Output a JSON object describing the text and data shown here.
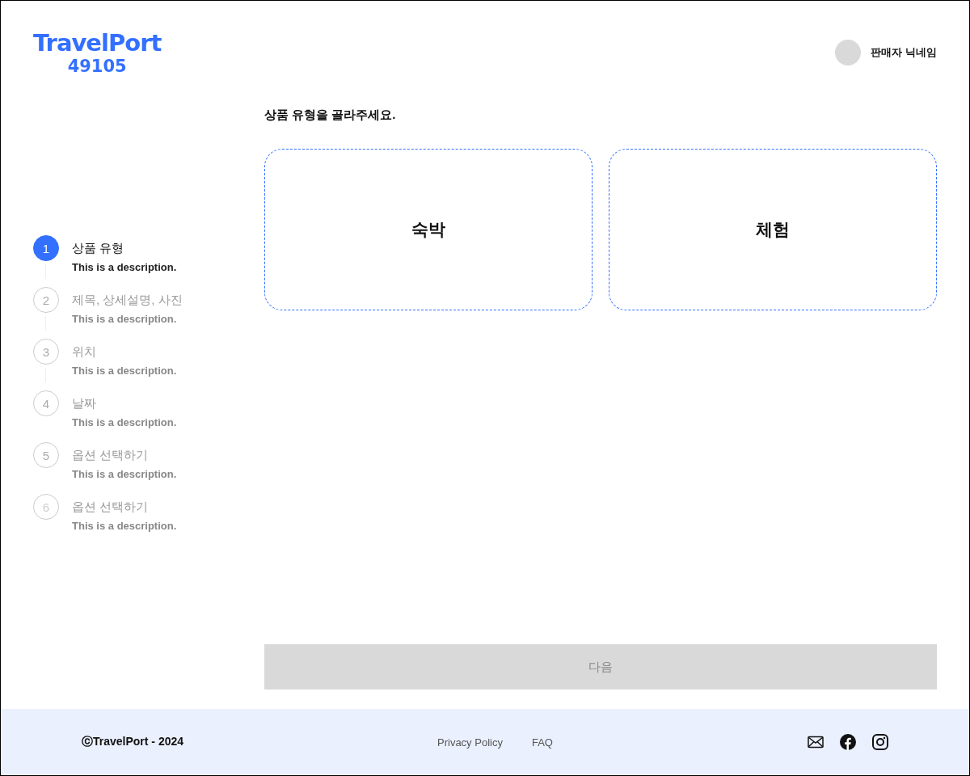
{
  "logo": {
    "name": "TravelPort",
    "code": "49105"
  },
  "user": {
    "nickname": "판매자 닉네임"
  },
  "steps": [
    {
      "number": "1",
      "title": "상품 유형",
      "description": "This is a description.",
      "selected": true,
      "disabled": false
    },
    {
      "number": "2",
      "title": "제목, 상세설명, 사진",
      "description": "This is a description.",
      "selected": false,
      "disabled": false
    },
    {
      "number": "3",
      "title": "위치",
      "description": "This is a description.",
      "selected": false,
      "disabled": false
    },
    {
      "number": "4",
      "title": "날짜",
      "description": "This is a description.",
      "selected": false,
      "disabled": false
    },
    {
      "number": "5",
      "title": "옵션 선택하기",
      "description": "This is a description.",
      "selected": false,
      "disabled": false
    },
    {
      "number": "6",
      "title": "옵션 선택하기",
      "description": "This is a description.",
      "selected": false,
      "disabled": true
    }
  ],
  "question": "상품 유형을 골라주세요.",
  "options": [
    {
      "label": "숙박",
      "selected": false
    },
    {
      "label": "체험",
      "selected": false
    }
  ],
  "next_button": {
    "label": "다음",
    "disabled": true
  },
  "footer": {
    "copyright": "ⓒTravelPort - 2024",
    "links": [
      "Privacy Policy",
      "FAQ"
    ]
  }
}
